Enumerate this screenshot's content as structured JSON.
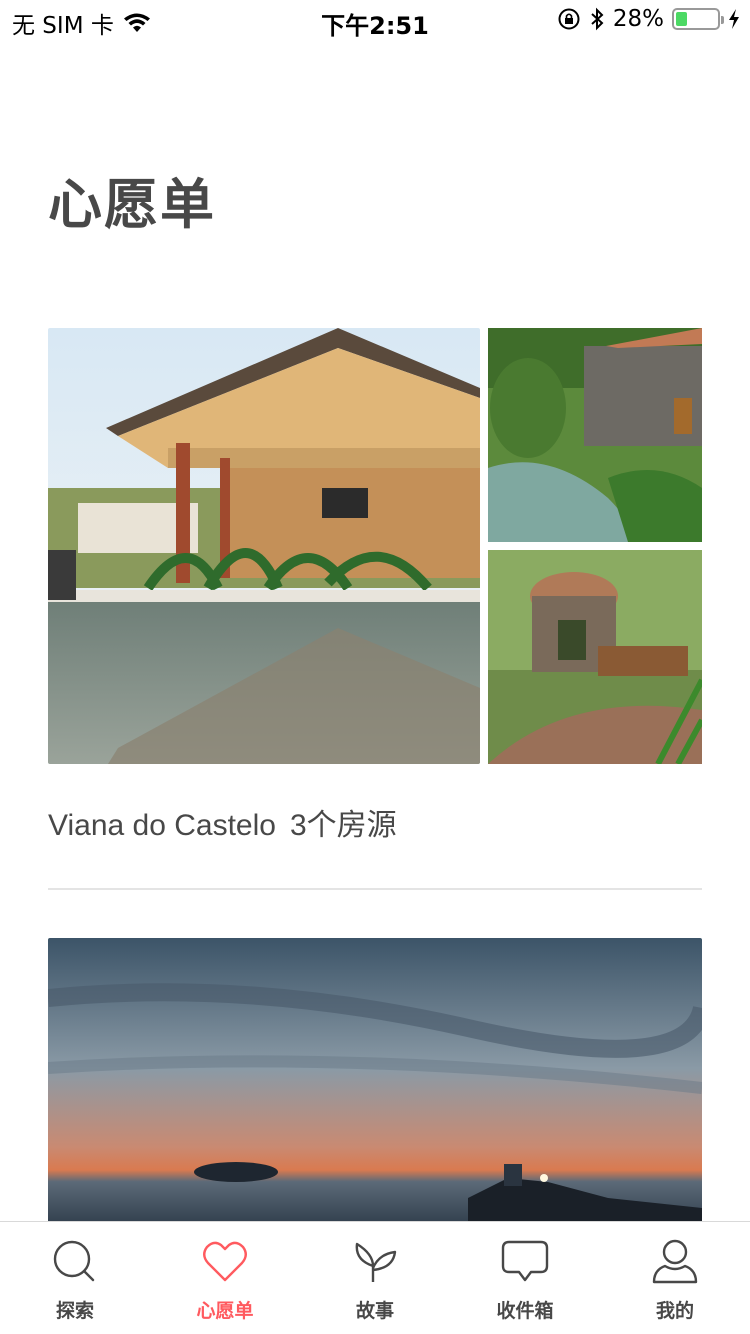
{
  "status_bar": {
    "carrier": "无 SIM 卡",
    "time": "下午2:51",
    "battery_percent": "28%",
    "battery_level": 0.28
  },
  "page": {
    "title": "心愿单"
  },
  "wishlists": [
    {
      "name": "Viana do Castelo",
      "count": "3个房源",
      "images": [
        "pool-pavilion",
        "stone-mill-stream",
        "treehouse-dome"
      ]
    },
    {
      "images": [
        "sunset-lighthouse"
      ]
    }
  ],
  "tab_bar": {
    "active_color": "#ff5a5f",
    "tabs": [
      {
        "label": "探索",
        "icon": "search-icon"
      },
      {
        "label": "心愿单",
        "icon": "heart-icon",
        "active": true
      },
      {
        "label": "故事",
        "icon": "sprout-icon"
      },
      {
        "label": "收件箱",
        "icon": "chat-bubble-icon"
      },
      {
        "label": "我的",
        "icon": "profile-icon"
      }
    ]
  }
}
